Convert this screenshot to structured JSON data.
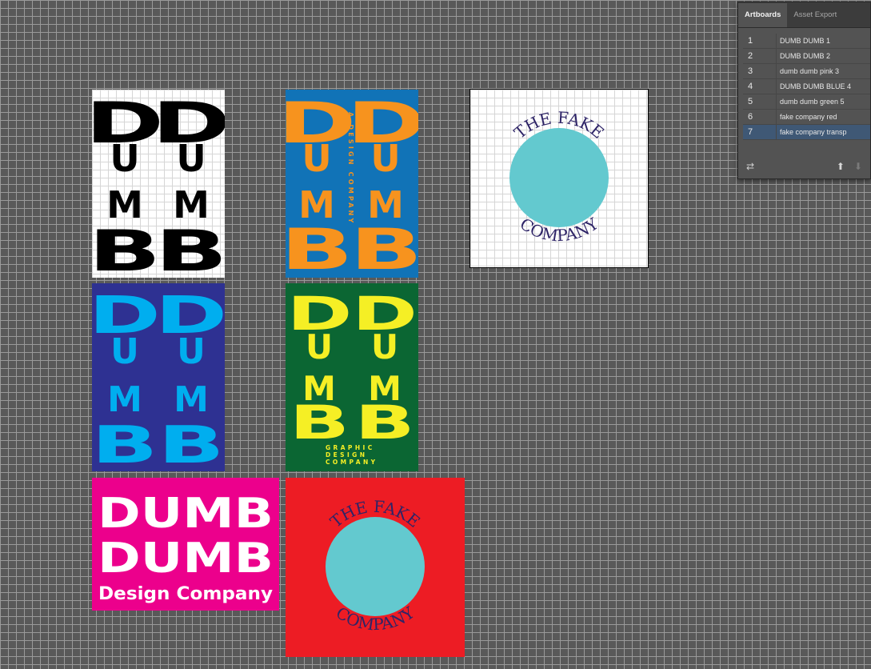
{
  "panel": {
    "tabs": [
      "Artboards",
      "Asset Export"
    ],
    "active_tab": 0,
    "artboards": [
      {
        "num": "1",
        "name": "DUMB DUMB 1"
      },
      {
        "num": "2",
        "name": "DUMB DUMB 2"
      },
      {
        "num": "3",
        "name": "dumb dumb pink 3"
      },
      {
        "num": "4",
        "name": "DUMB DUMB BLUE 4"
      },
      {
        "num": "5",
        "name": "dumb dumb green 5"
      },
      {
        "num": "6",
        "name": "fake company red"
      },
      {
        "num": "7",
        "name": "fake company transp"
      }
    ],
    "selected_index": 6,
    "icons": {
      "rearrange": "rearrange-artboards-icon",
      "up": "move-up-icon",
      "down": "move-down-icon"
    }
  },
  "designs": {
    "dumb_letters": [
      "D",
      "U",
      "M",
      "B"
    ],
    "tagline_a": "A DESIGN COMPANY",
    "tagline_graphic": [
      "GRAPHIC",
      "DESIGN",
      "COMPANY"
    ],
    "pink_line1": "DUMB",
    "pink_line2": "DUMB",
    "pink_tag": "Design Company",
    "fake_top": "THE FAKE",
    "fake_bottom": "COMPANY"
  },
  "colors": {
    "black": "#000000",
    "blue_bg": "#1173b7",
    "orange": "#f7931e",
    "navy_bg": "#2e3192",
    "cyan": "#00aeef",
    "green_bg": "#0b6633",
    "yellow": "#f5ef25",
    "pink_bg": "#ec008c",
    "red_bg": "#ed1c24",
    "teal": "#63c9cf",
    "fake_text": "#2e2467"
  }
}
